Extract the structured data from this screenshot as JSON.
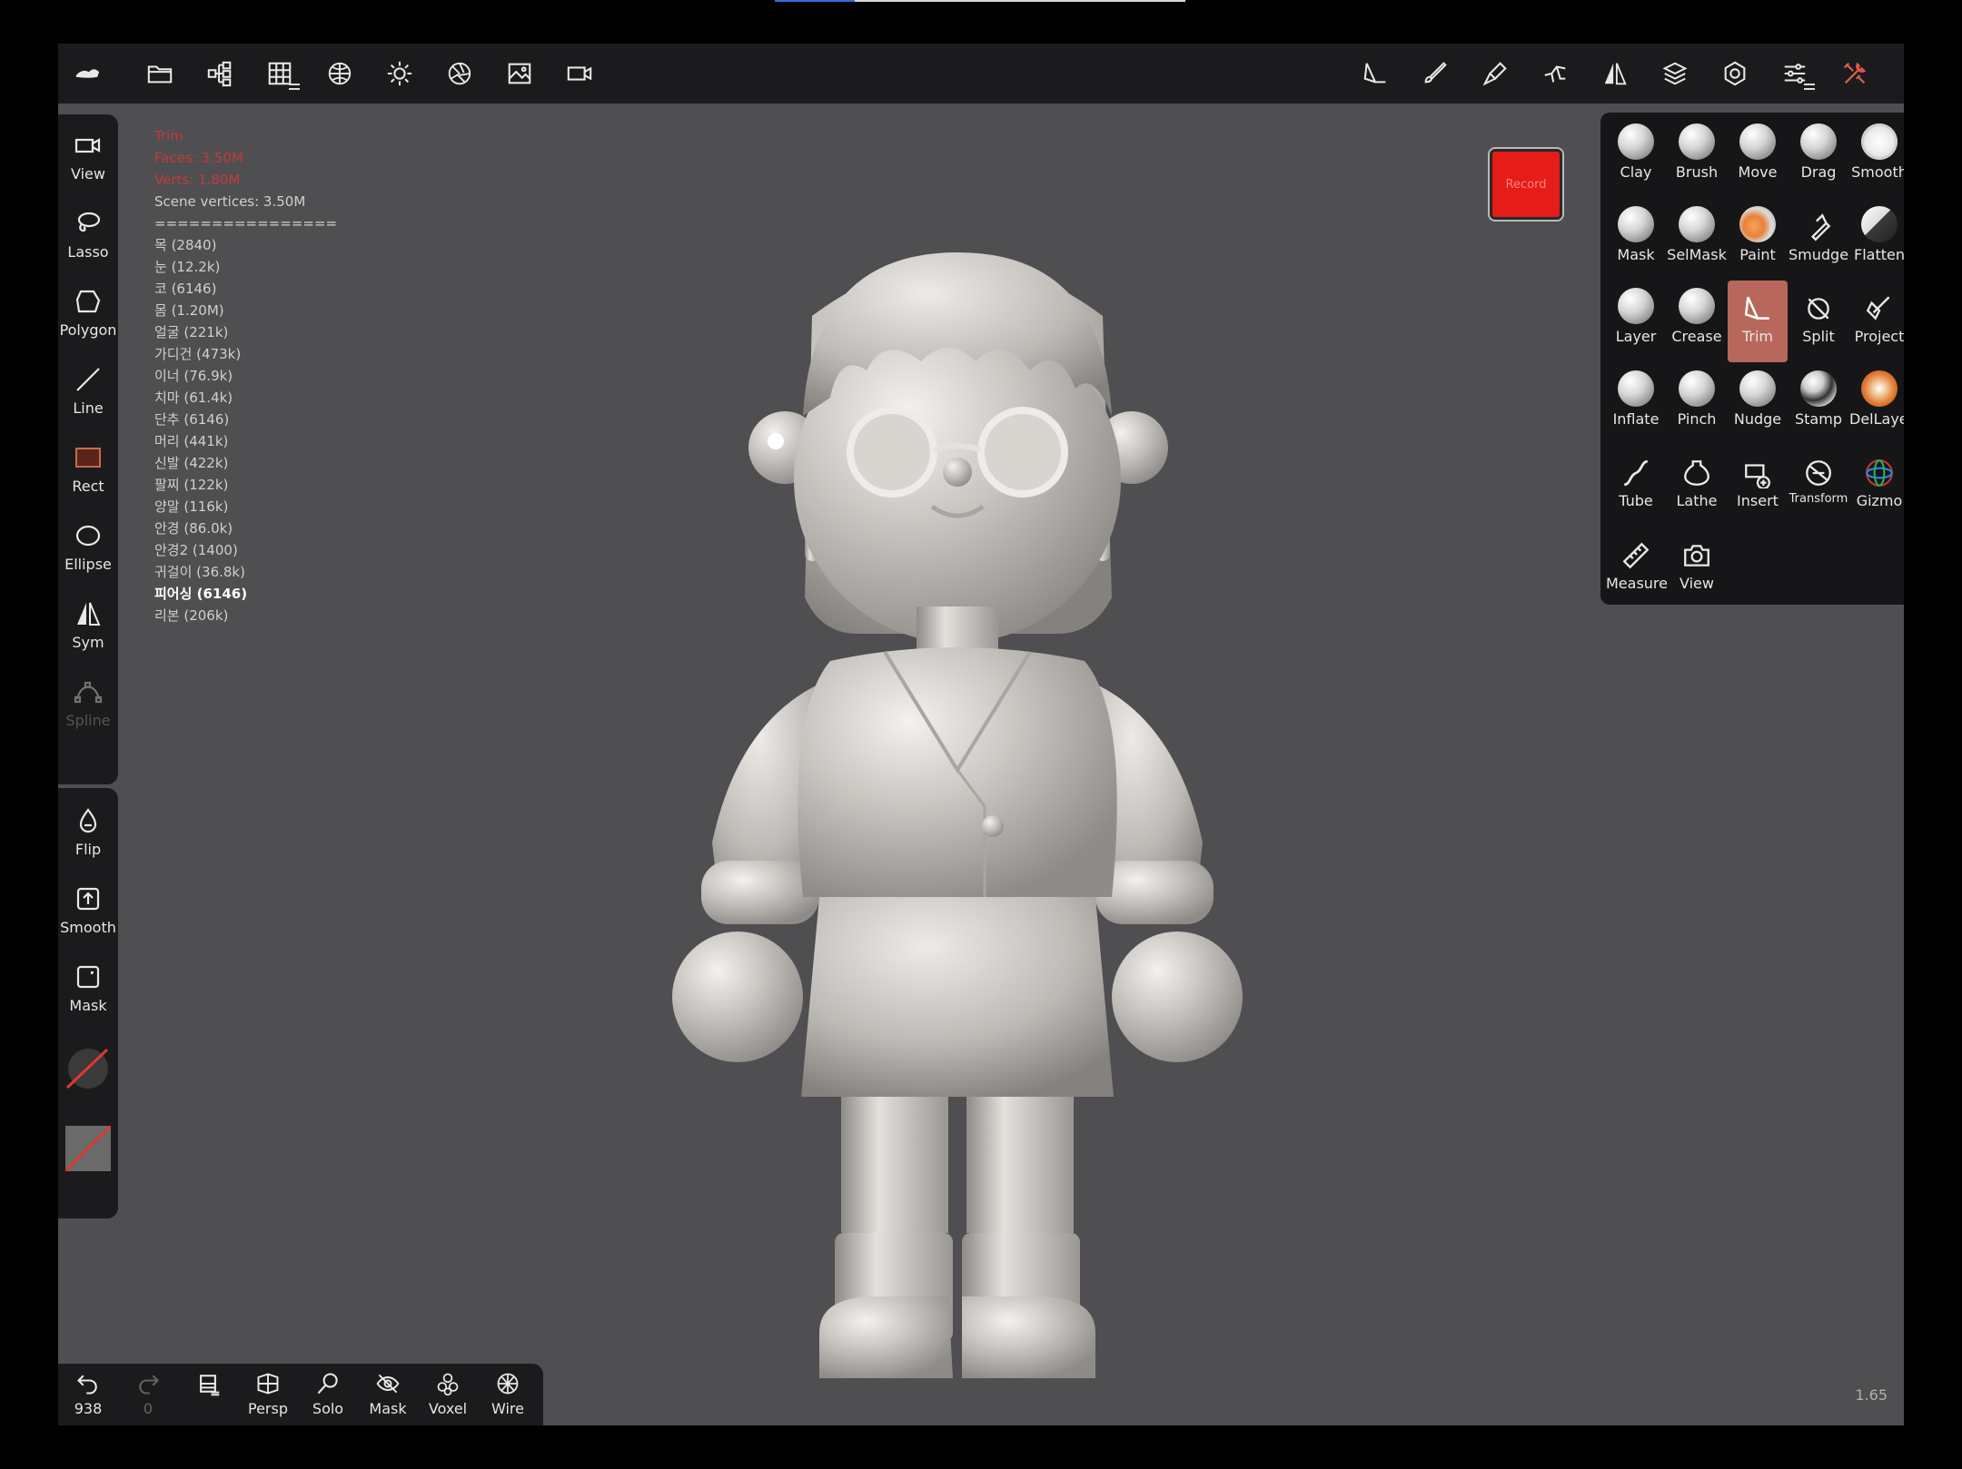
{
  "top_toolbar": {
    "left_icons": [
      "app-logo-icon",
      "folder-icon",
      "scene-tree-icon",
      "grid-icon",
      "material-sphere-icon",
      "light-icon",
      "aperture-icon",
      "image-icon",
      "camera-icon"
    ],
    "right_icons": [
      "trim-tool-icon",
      "brush-tool-icon",
      "stroke-icon",
      "pose-icon",
      "symmetry-icon",
      "layers-icon",
      "settings-icon",
      "sliders-icon",
      "tools-icon"
    ]
  },
  "left_toolbar": {
    "group1": [
      {
        "label": "View",
        "icon": "camera-icon"
      },
      {
        "label": "Lasso",
        "icon": "lasso-icon"
      },
      {
        "label": "Polygon",
        "icon": "polygon-icon"
      },
      {
        "label": "Line",
        "icon": "line-icon"
      },
      {
        "label": "Rect",
        "icon": "rect-icon"
      },
      {
        "label": "Ellipse",
        "icon": "ellipse-icon"
      },
      {
        "label": "Sym",
        "icon": "symmetry-icon"
      },
      {
        "label": "Spline",
        "icon": "spline-icon"
      }
    ],
    "group2": [
      {
        "label": "Flip",
        "icon": "flip-icon"
      },
      {
        "label": "Smooth",
        "icon": "smooth-icon"
      },
      {
        "label": "Mask",
        "icon": "mask-icon"
      }
    ]
  },
  "scene_info": {
    "red_lines": [
      "Trim",
      "Faces: 3.50M",
      "Verts: 1.80M"
    ],
    "vertices": "Scene vertices: 3.50M",
    "separator": "================",
    "objects": [
      "목 (2840)",
      "눈 (12.2k)",
      "코 (6146)",
      "몸 (1.20M)",
      "얼굴 (221k)",
      "가디건 (473k)",
      "이너 (76.9k)",
      "치마 (61.4k)",
      "단추 (6146)",
      "머리 (441k)",
      "신발 (422k)",
      "팔찌 (122k)",
      "양말 (116k)",
      "안경 (86.0k)",
      "안경2 (1400)",
      "귀걸이 (36.8k)"
    ],
    "selected": "피어싱 (6146)",
    "last": "리본 (206k)"
  },
  "record_button": {
    "label": "Record",
    "color": "#e51c17"
  },
  "tools": [
    {
      "label": "Clay",
      "kind": "ball"
    },
    {
      "label": "Brush",
      "kind": "ball"
    },
    {
      "label": "Move",
      "kind": "ball"
    },
    {
      "label": "Drag",
      "kind": "ball"
    },
    {
      "label": "Smooth",
      "kind": "smooth"
    },
    {
      "label": "Mask",
      "kind": "ball"
    },
    {
      "label": "SelMask",
      "kind": "ball"
    },
    {
      "label": "Paint",
      "kind": "paint"
    },
    {
      "label": "Smudge",
      "kind": "glyph",
      "icon": "smudge-icon"
    },
    {
      "label": "Flatten",
      "kind": "flat"
    },
    {
      "label": "Layer",
      "kind": "ball"
    },
    {
      "label": "Crease",
      "kind": "ball"
    },
    {
      "label": "Trim",
      "kind": "glyph",
      "icon": "trim-icon",
      "active": true
    },
    {
      "label": "Split",
      "kind": "glyph",
      "icon": "split-icon"
    },
    {
      "label": "Project",
      "kind": "glyph",
      "icon": "project-icon"
    },
    {
      "label": "Inflate",
      "kind": "ball"
    },
    {
      "label": "Pinch",
      "kind": "ball"
    },
    {
      "label": "Nudge",
      "kind": "ball"
    },
    {
      "label": "Stamp",
      "kind": "stamp"
    },
    {
      "label": "DelLayer",
      "kind": "del"
    },
    {
      "label": "Tube",
      "kind": "glyph",
      "icon": "tube-icon"
    },
    {
      "label": "Lathe",
      "kind": "glyph",
      "icon": "lathe-icon"
    },
    {
      "label": "Insert",
      "kind": "glyph",
      "icon": "insert-icon"
    },
    {
      "label": "Transform",
      "kind": "glyph",
      "icon": "transform-icon",
      "small": true
    },
    {
      "label": "Gizmo",
      "kind": "glyph",
      "icon": "gizmo-icon"
    },
    {
      "label": "Measure",
      "kind": "glyph",
      "icon": "ruler-icon"
    },
    {
      "label": "View",
      "kind": "glyph",
      "icon": "camera-photo-icon"
    }
  ],
  "bottom_toolbar": [
    {
      "label": "938",
      "icon": "undo-icon"
    },
    {
      "label": "0",
      "icon": "redo-icon",
      "dim": true
    },
    {
      "label": "",
      "icon": "menu-icon"
    },
    {
      "label": "Persp",
      "icon": "perspective-icon"
    },
    {
      "label": "Solo",
      "icon": "solo-icon"
    },
    {
      "label": "Mask",
      "icon": "mask-eye-icon"
    },
    {
      "label": "Voxel",
      "icon": "voxel-icon"
    },
    {
      "label": "Wire",
      "icon": "wire-icon"
    }
  ],
  "zoom_readout": "1.65"
}
